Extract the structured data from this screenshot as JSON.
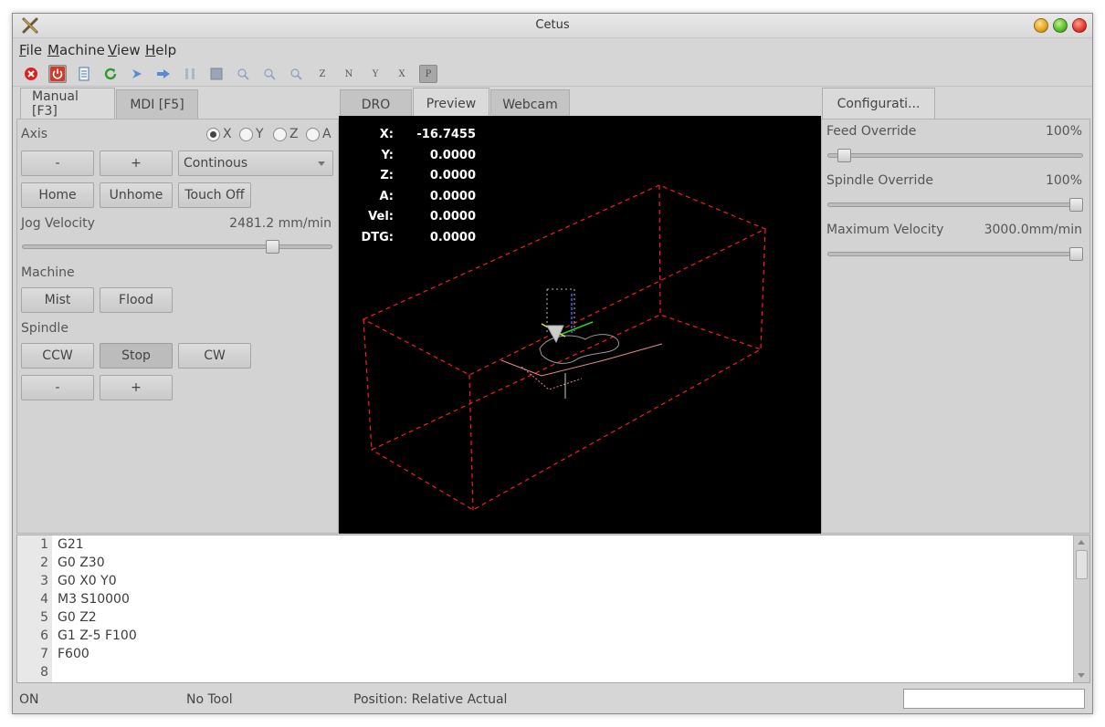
{
  "window": {
    "title": "Cetus"
  },
  "menu": [
    {
      "first": "F",
      "rest": "ile"
    },
    {
      "first": "M",
      "rest": "achine"
    },
    {
      "first": "V",
      "rest": "iew"
    },
    {
      "first": "H",
      "rest": "elp"
    }
  ],
  "toolbar": {
    "letters": [
      "Z",
      "N",
      "Y",
      "X",
      "P"
    ]
  },
  "left_panel": {
    "tabs": [
      "Manual [F3]",
      "MDI [F5]"
    ],
    "axis_label": "Axis",
    "axes": [
      "X",
      "Y",
      "Z",
      "A"
    ],
    "selected_axis": "X",
    "jog_minus": "-",
    "jog_plus": "+",
    "jog_mode": "Continous",
    "home": "Home",
    "unhome": "Unhome",
    "touch_off": "Touch Off",
    "jog_velocity_label": "Jog Velocity",
    "jog_velocity_value": "2481.2 mm/min",
    "jog_velocity_fraction": 0.82,
    "machine_label": "Machine",
    "mist": "Mist",
    "flood": "Flood",
    "spindle_label": "Spindle",
    "ccw": "CCW",
    "stop": "Stop",
    "cw": "CW",
    "spindle_minus": "-",
    "spindle_plus": "+"
  },
  "center_panel": {
    "tabs": [
      "DRO",
      "Preview",
      "Webcam"
    ],
    "selected_tab": "Preview",
    "dro": [
      {
        "label": "X:",
        "value": "-16.7455"
      },
      {
        "label": "Y:",
        "value": "0.0000"
      },
      {
        "label": "Z:",
        "value": "0.0000"
      },
      {
        "label": "A:",
        "value": "0.0000"
      },
      {
        "label": "Vel:",
        "value": "0.0000"
      },
      {
        "label": "DTG:",
        "value": "0.0000"
      }
    ]
  },
  "right_panel": {
    "tab": "Configurati...",
    "feed_override_label": "Feed Override",
    "feed_override_value": "100%",
    "feed_override_fraction": 0.04,
    "spindle_override_label": "Spindle Override",
    "spindle_override_value": "100%",
    "spindle_override_fraction": 1.0,
    "max_velocity_label": "Maximum Velocity",
    "max_velocity_value": "3000.0mm/min",
    "max_velocity_fraction": 1.0
  },
  "editor": {
    "lines": [
      "G21",
      "G0 Z30",
      "G0 X0 Y0",
      "M3 S10000",
      "G0 Z2",
      "G1 Z-5 F100",
      "F600",
      ""
    ]
  },
  "status": {
    "machine_state": "ON",
    "tool": "No Tool",
    "position": "Position: Relative Actual"
  },
  "colors": {
    "preview_bg": "#000000",
    "boundary": "#ff1a1a"
  }
}
